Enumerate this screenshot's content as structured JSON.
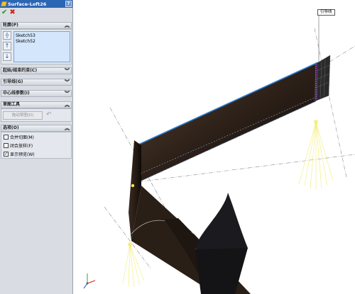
{
  "panel": {
    "title": "Surface-Loft26",
    "help_label": "?",
    "ok_icon": "checkmark-icon",
    "cancel_icon": "x-icon",
    "sections": {
      "profiles": "轮廓(P)",
      "start_end": "起始/结束约束(C)",
      "guides": "引导线(G)",
      "centerline": "中心线参数(I)",
      "sketch_tools": "草图工具",
      "options": "选项(O)"
    },
    "profile_items": [
      "Sketch53",
      "Sketch52"
    ],
    "drag_sketch_label": "拖动草图(D)",
    "options": [
      {
        "label": "合并切面(M)",
        "checked": false
      },
      {
        "label": "闭合放样(F)",
        "checked": false
      },
      {
        "label": "显示预览(W)",
        "checked": true
      }
    ],
    "colors": {
      "title_bar": "#2b66b5",
      "list_bg": "#d3e6fb"
    }
  },
  "viewport": {
    "callout_text": "引导线",
    "colors": {
      "surface": "#3b2a1e",
      "edge_highlight": "#2e7fd8",
      "guide_lines": "#f2ea55",
      "preview_points": "#a040d0"
    }
  }
}
